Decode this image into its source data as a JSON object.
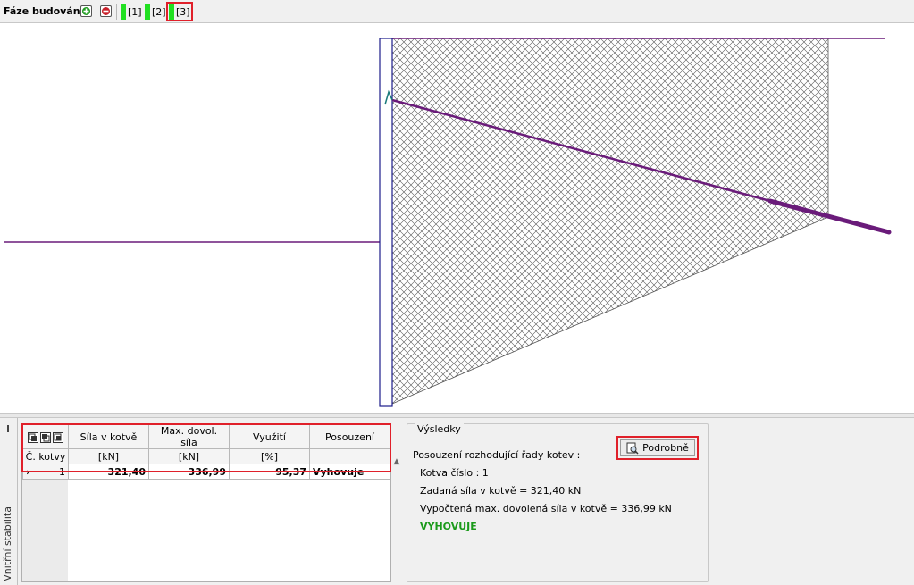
{
  "toolbar": {
    "label": "Fáze budování :",
    "add_icon": "plus-circle-icon",
    "remove_icon": "minus-circle-icon",
    "stages": [
      {
        "label": "[1]",
        "active": false
      },
      {
        "label": "[2]",
        "active": false
      },
      {
        "label": "[3]",
        "active": true
      }
    ],
    "stage_color": "#21e021",
    "highlight_color": "#e0202a"
  },
  "drawing": {
    "line_color": "#6a1b7a",
    "hatch_color": "#555555"
  },
  "side_tab": {
    "label": "Vnitřní stabilita"
  },
  "table": {
    "header_icons": [
      "copy-rows-icon",
      "paste-rows-icon",
      "export-rows-icon"
    ],
    "columns": [
      {
        "top": "",
        "bottom": "Č. kotvy"
      },
      {
        "top": "Síla v kotvě",
        "bottom": "[kN]"
      },
      {
        "top": "Max. dovol. síla",
        "bottom": "[kN]"
      },
      {
        "top": "Využití",
        "bottom": "[%]"
      },
      {
        "top": "Posouzení",
        "bottom": ""
      }
    ],
    "rows": [
      {
        "marker": "›",
        "no": "1",
        "force": "321,40",
        "max_force": "336,99",
        "utilization": "95,37",
        "verdict": "Vyhovuje"
      }
    ]
  },
  "results": {
    "legend": "Výsledky",
    "heading": "Posouzení rozhodující řady kotev :",
    "anchor_no": "Kotva číslo : 1",
    "given_force": "Zadaná síla v kotvě = 321,40 kN",
    "computed_max": "Vypočtená max. dovolená síla v kotvě = 336,99 kN",
    "verdict": "VYHOVUJE",
    "verdict_color": "#1a9a1a",
    "detail_button": "Podrobně",
    "detail_icon": "magnifier-document-icon"
  }
}
